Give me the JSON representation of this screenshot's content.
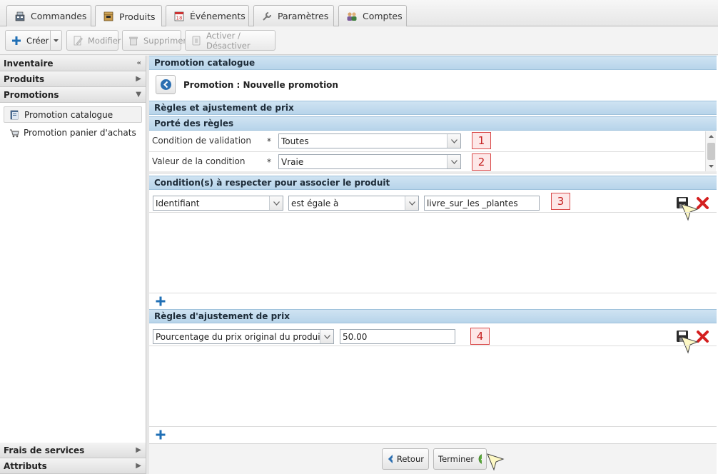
{
  "tabs": [
    {
      "label": "Commandes",
      "icon": "register-icon"
    },
    {
      "label": "Produits",
      "icon": "box-icon",
      "active": true
    },
    {
      "label": "Événements",
      "icon": "calendar-icon"
    },
    {
      "label": "Paramètres",
      "icon": "wrench-icon"
    },
    {
      "label": "Comptes",
      "icon": "users-icon"
    }
  ],
  "toolbar": {
    "create_label": "Créer",
    "edit_label": "Modifier",
    "delete_label": "Supprimer",
    "toggle_label": "Activer / Désactiver"
  },
  "sidebar": {
    "sections": {
      "inventory": "Inventaire",
      "products": "Produits",
      "promotions": "Promotions",
      "service_fees": "Frais de services",
      "attributes": "Attributs"
    },
    "items": [
      {
        "label": "Promotion catalogue",
        "selected": true
      },
      {
        "label": "Promotion panier d'achats"
      }
    ]
  },
  "main": {
    "panel_title": "Promotion catalogue",
    "page_title": "Promotion : Nouvelle promotion",
    "section_rules": "Règles et ajustement de prix",
    "section_scope": "Porté des règles",
    "scope_fields": [
      {
        "label": "Condition de validation",
        "required": "*",
        "value": "Toutes",
        "marker": "1"
      },
      {
        "label": "Valeur de la condition",
        "required": "*",
        "value": "Vraie",
        "marker": "2"
      }
    ],
    "section_conditions": "Condition(s) à respecter pour associer le produit",
    "condition_row": {
      "attribute": "Identifiant",
      "operator": "est égale à",
      "value": "livre_sur_les _plantes",
      "marker": "3"
    },
    "section_adjust": "Règles d'ajustement de prix",
    "adjust_row": {
      "type": "Pourcentage du prix original du produit",
      "value": "50.00",
      "marker": "4"
    }
  },
  "footer": {
    "back_label": "Retour",
    "finish_label": "Terminer"
  },
  "colors": {
    "band": "#bcd6eb",
    "badge_border": "#d94a4a",
    "badge_text": "#c41f1f",
    "delete_red": "#d42020",
    "add_blue": "#1f6fb5"
  }
}
